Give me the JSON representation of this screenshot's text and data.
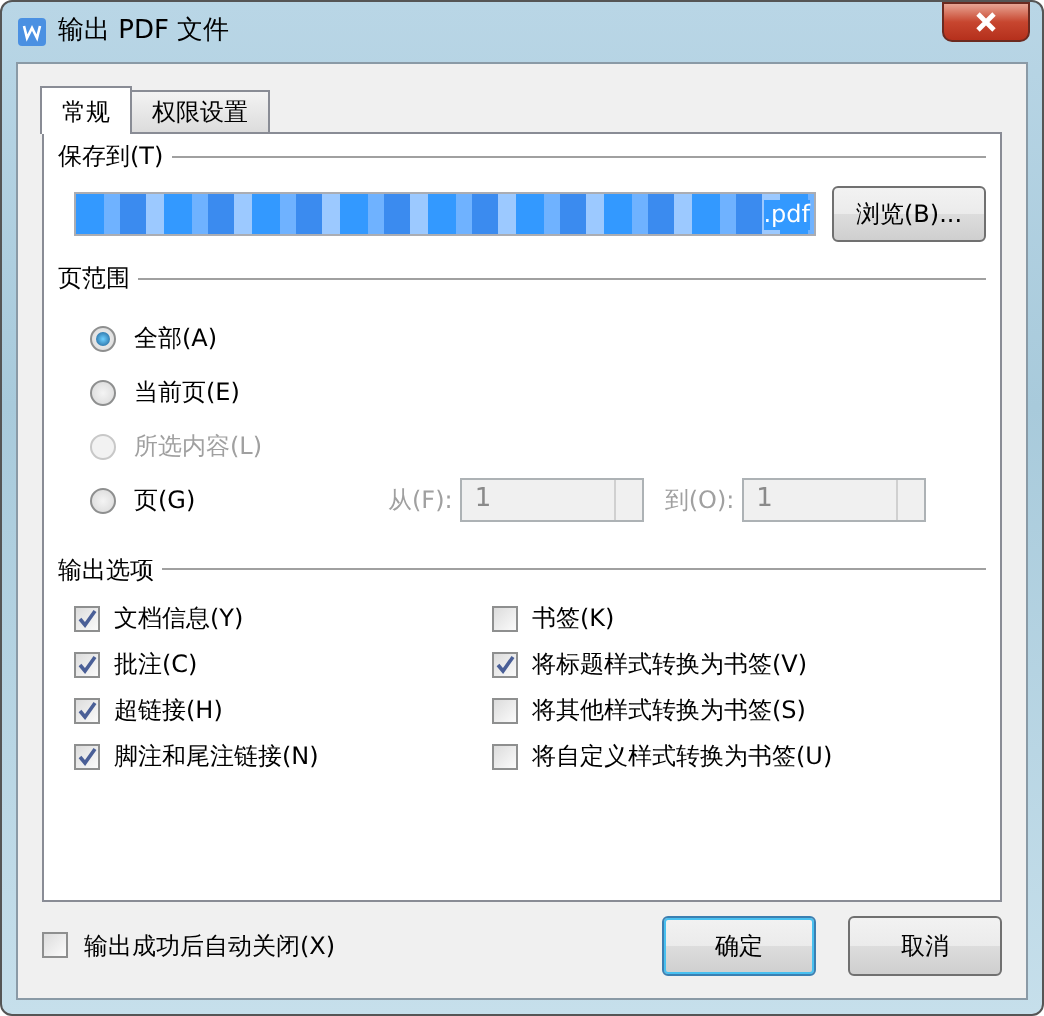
{
  "window": {
    "title": "输出 PDF 文件"
  },
  "tabs": [
    {
      "label": "常规",
      "selected": true
    },
    {
      "label": "权限设置",
      "selected": false
    }
  ],
  "save_to": {
    "label": "保存到(T)",
    "value": ".pdf",
    "browse": "浏览(B)..."
  },
  "page_range": {
    "label": "页范围",
    "options": [
      {
        "label": "全部(A)",
        "selected": true,
        "disabled": false
      },
      {
        "label": "当前页(E)",
        "selected": false,
        "disabled": false
      },
      {
        "label": "所选内容(L)",
        "selected": false,
        "disabled": true
      },
      {
        "label": "页(G)",
        "selected": false,
        "disabled": false
      }
    ],
    "from_label": "从(F):",
    "from_value": "1",
    "to_label": "到(O):",
    "to_value": "1",
    "range_disabled": true
  },
  "output_options": {
    "label": "输出选项",
    "columns": [
      [
        {
          "label": "文档信息(Y)",
          "checked": true
        },
        {
          "label": "批注(C)",
          "checked": true
        },
        {
          "label": "超链接(H)",
          "checked": true
        },
        {
          "label": "脚注和尾注链接(N)",
          "checked": true
        }
      ],
      [
        {
          "label": "书签(K)",
          "checked": false
        },
        {
          "label": "将标题样式转换为书签(V)",
          "checked": true
        },
        {
          "label": "将其他样式转换为书签(S)",
          "checked": false
        },
        {
          "label": "将自定义样式转换为书签(U)",
          "checked": false
        }
      ]
    ]
  },
  "auto_close": {
    "label": "输出成功后自动关闭(X)",
    "checked": false
  },
  "buttons": [
    {
      "label": "确定",
      "kind": "default"
    },
    {
      "label": "取消",
      "kind": "normal"
    }
  ]
}
